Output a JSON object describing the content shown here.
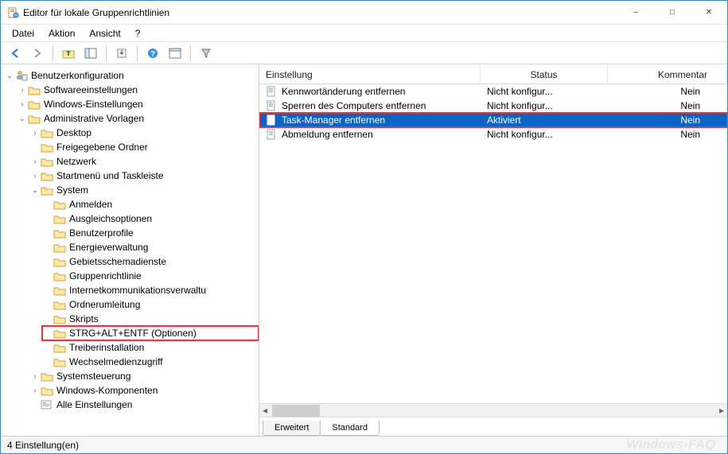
{
  "window": {
    "title": "Editor für lokale Gruppenrichtlinien"
  },
  "menu": {
    "file": "Datei",
    "action": "Aktion",
    "view": "Ansicht",
    "help": "?"
  },
  "toolbar_icons": [
    "back",
    "forward",
    "up",
    "frame",
    "export",
    "help",
    "props",
    "filter"
  ],
  "tree": {
    "root": {
      "label": "Benutzerkonfiguration"
    },
    "software": "Softwareeinstellungen",
    "windows": "Windows-Einstellungen",
    "admin": {
      "label": "Administrative Vorlagen",
      "desktop": "Desktop",
      "shared": "Freigegebene Ordner",
      "network": "Netzwerk",
      "startmenu": "Startmenü und Taskleiste",
      "system": {
        "label": "System",
        "items": [
          "Anmelden",
          "Ausgleichsoptionen",
          "Benutzerprofile",
          "Energieverwaltung",
          "Gebietsschemadienste",
          "Gruppenrichtlinie",
          "Internetkommunikationsverwaltu",
          "Ordnerumleitung",
          "Skripts",
          "STRG+ALT+ENTF (Optionen)",
          "Treiberinstallation",
          "Wechselmedienzugriff"
        ],
        "selected_index": 9
      },
      "control": "Systemsteuerung",
      "wincomp": "Windows-Komponenten",
      "all": "Alle Einstellungen"
    }
  },
  "columns": {
    "name": "Einstellung",
    "status": "Status",
    "comment": "Kommentar"
  },
  "rows": [
    {
      "name": "Kennwortänderung entfernen",
      "status": "Nicht konfigur...",
      "comment": "Nein",
      "selected": false
    },
    {
      "name": "Sperren des Computers entfernen",
      "status": "Nicht konfigur...",
      "comment": "Nein",
      "selected": false
    },
    {
      "name": "Task-Manager entfernen",
      "status": "Aktiviert",
      "comment": "Nein",
      "selected": true
    },
    {
      "name": "Abmeldung entfernen",
      "status": "Nicht konfigur...",
      "comment": "Nein",
      "selected": false
    }
  ],
  "tabs": {
    "extended": "Erweitert",
    "standard": "Standard"
  },
  "status": {
    "text": "4 Einstellung(en)"
  },
  "watermark": "Windows-FAQ"
}
